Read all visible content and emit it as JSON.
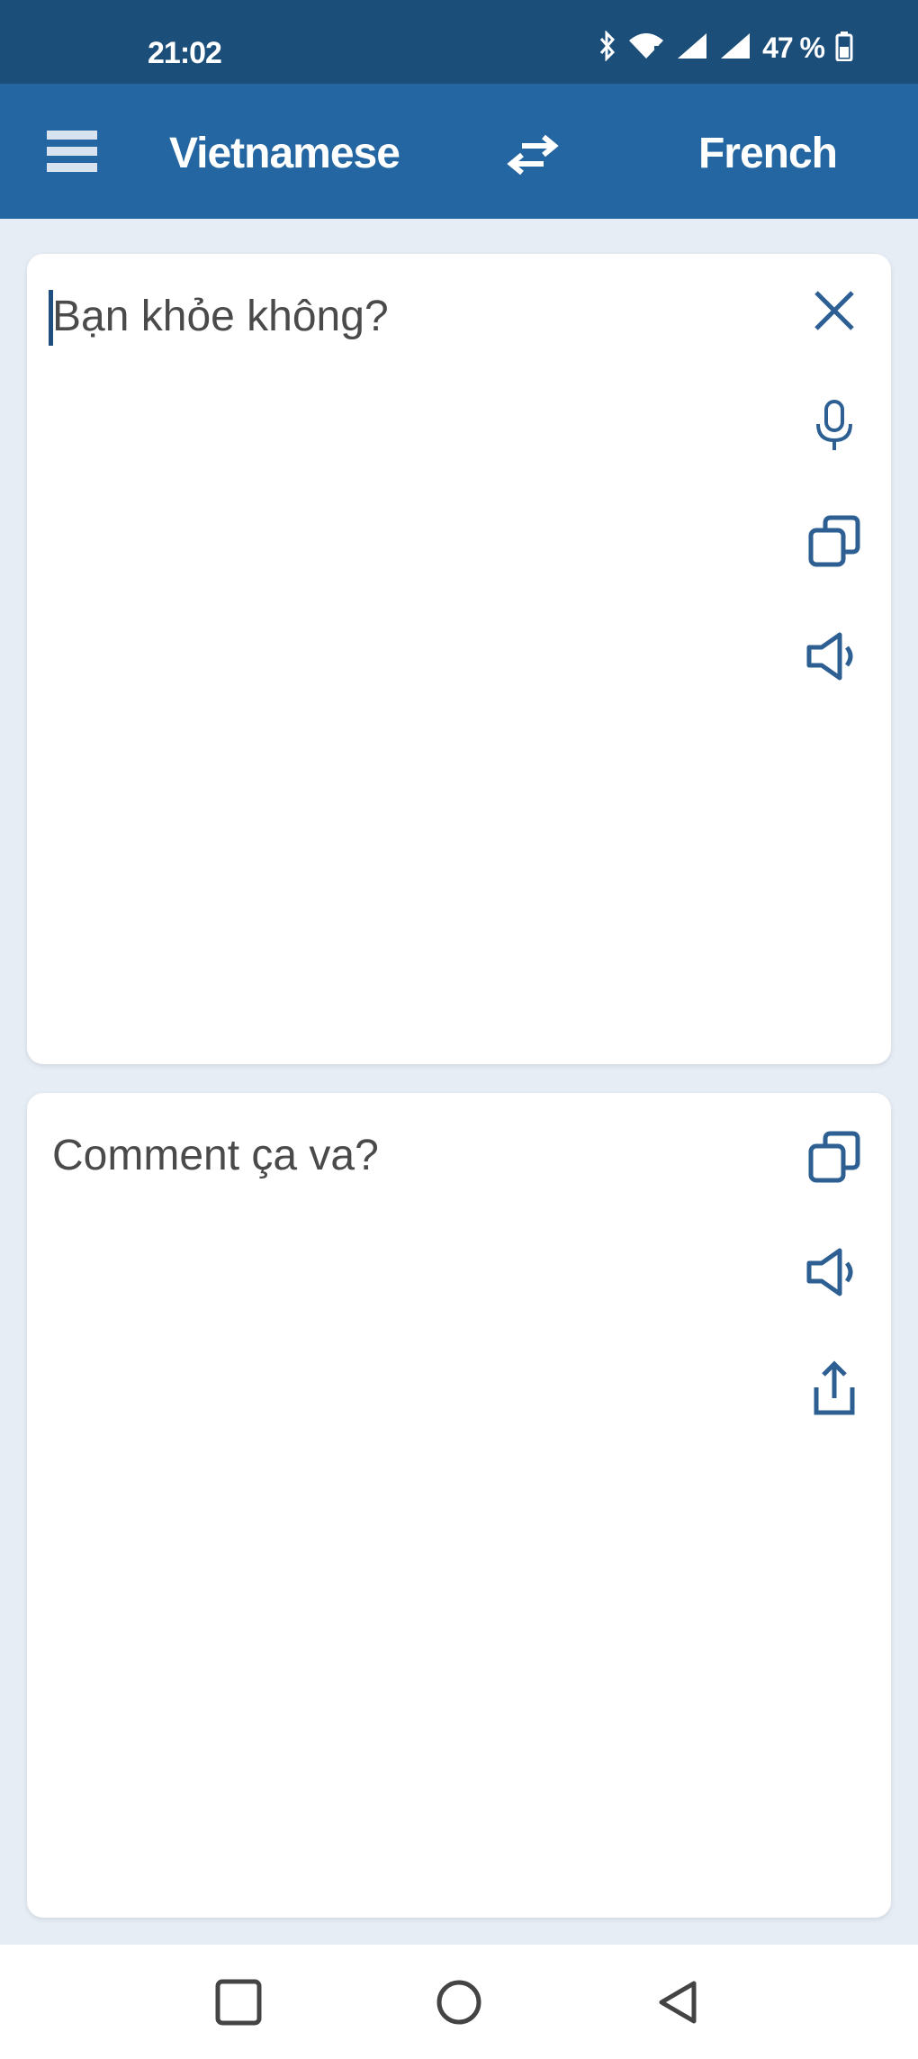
{
  "status_bar": {
    "time": "21:02",
    "battery_text": "47 %",
    "icons": [
      "bluetooth-icon",
      "wifi-icon",
      "signal-icon",
      "signal-icon",
      "battery-icon"
    ]
  },
  "app_bar": {
    "source_language": "Vietnamese",
    "target_language": "French",
    "icons": [
      "menu-icon",
      "swap-icon"
    ]
  },
  "source_card": {
    "text": "Bạn khỏe không?",
    "icons": [
      "close-icon",
      "microphone-icon",
      "copy-icon",
      "speaker-icon"
    ]
  },
  "target_card": {
    "text": "Comment ça va?",
    "icons": [
      "copy-icon",
      "speaker-icon",
      "share-icon"
    ]
  },
  "nav_bar": {
    "icons": [
      "recents-icon",
      "home-icon",
      "back-icon"
    ]
  },
  "colors": {
    "status_bar": "#1c4e7a",
    "app_bar": "#2366a1",
    "background": "#e6edf5",
    "icon_accent": "#2d5f93",
    "card": "#ffffff"
  }
}
